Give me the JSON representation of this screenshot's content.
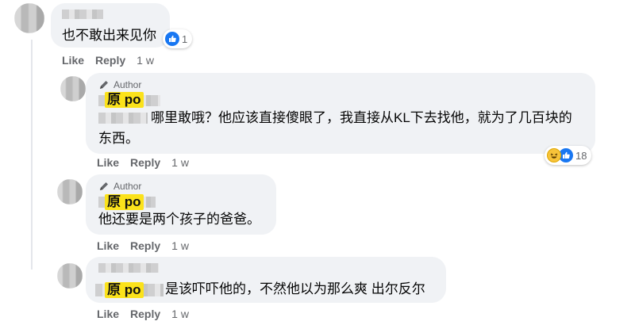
{
  "comments": [
    {
      "text": "也不敢出来见你",
      "reactions": {
        "icons": [
          "like-icon"
        ],
        "count": "1"
      },
      "actions": {
        "like": "Like",
        "reply": "Reply",
        "time": "1 w"
      }
    },
    {
      "author_tag": "Author",
      "name_label": "原 po",
      "text_line1": "哪里敢哦？他应该直接傻眼了，我直接从KL下去找他，就为了几百块的",
      "text_line2": "东西。",
      "reactions": {
        "icons": [
          "haha-icon",
          "like-icon"
        ],
        "count": "18"
      },
      "actions": {
        "like": "Like",
        "reply": "Reply",
        "time": "1 w"
      }
    },
    {
      "author_tag": "Author",
      "name_label": "原 po",
      "text": "他还要是两个孩子的爸爸。",
      "actions": {
        "like": "Like",
        "reply": "Reply",
        "time": "1 w"
      }
    },
    {
      "name_label": "原 po",
      "text": "是该吓吓他的，不然他以为那么爽 出尔反尔",
      "actions": {
        "like": "Like",
        "reply": "Reply",
        "time": "1 w"
      }
    }
  ],
  "colors": {
    "bubble": "#f0f2f5",
    "meta": "#65676b",
    "highlight": "#fbe21b",
    "like_blue": "#1877f2"
  }
}
